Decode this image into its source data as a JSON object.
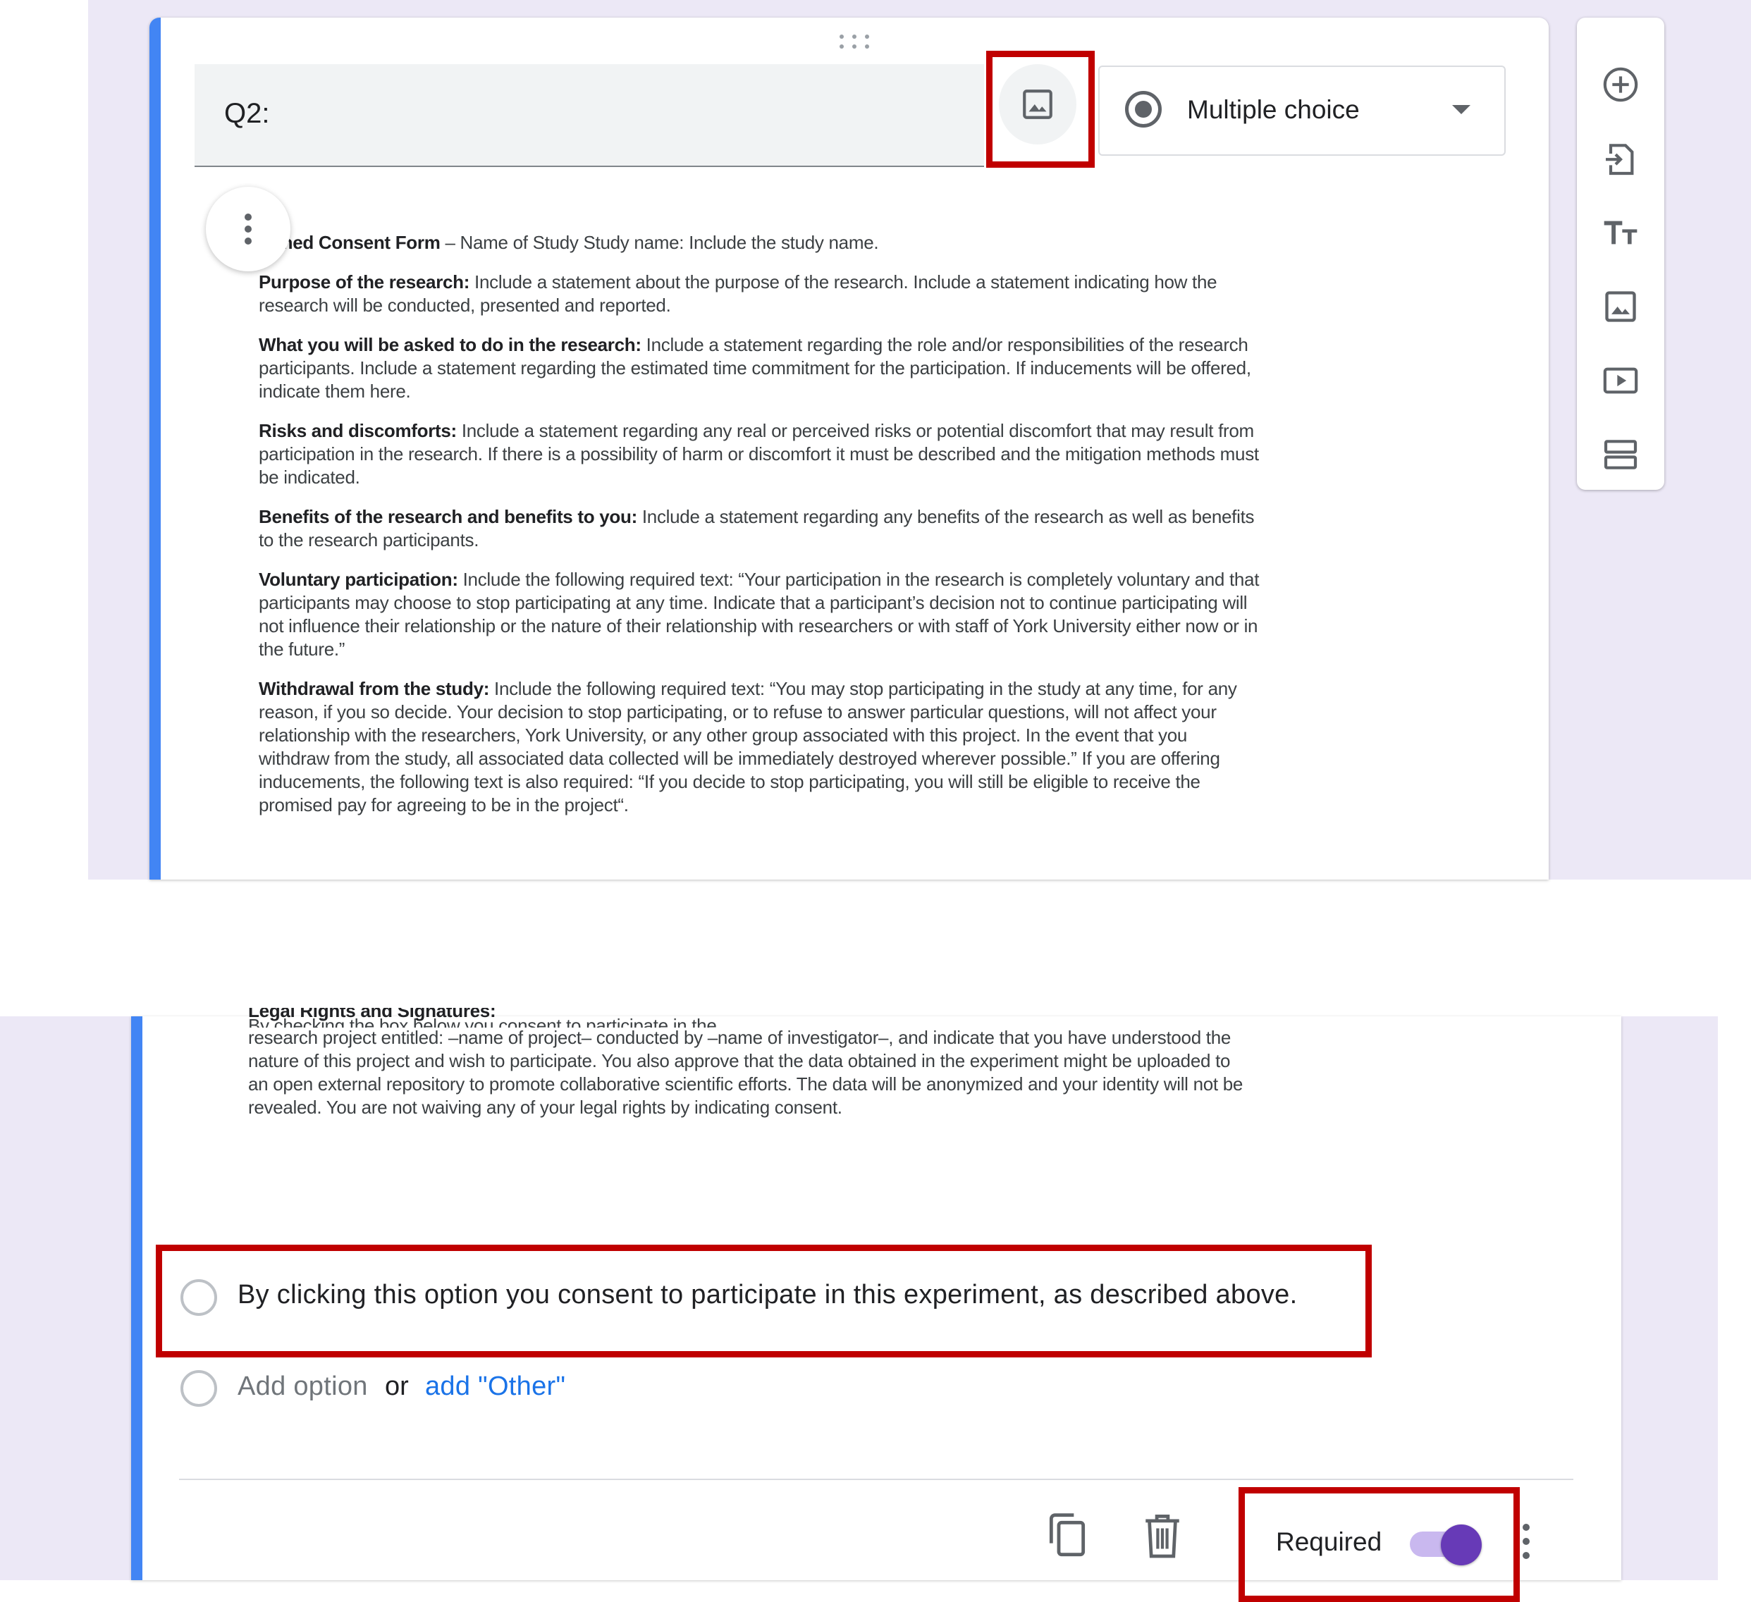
{
  "question": {
    "title": "Q2:",
    "type_label": "Multiple choice"
  },
  "consent_image": {
    "heading_bold": "ormed Consent Form",
    "heading_rest": " – Name of Study Study name: Include the study name.",
    "paragraphs": [
      {
        "bold": "Purpose of the research:",
        "text": " Include a statement about the purpose of the research. Include a statement indicating how the research will be conducted, presented and reported."
      },
      {
        "bold": "What you will be asked to do in the research:",
        "text": " Include a statement regarding the role and/or responsibilities of the research participants. Include a statement regarding the estimated time commitment for the participation. If inducements will be offered, indicate them here."
      },
      {
        "bold": "Risks and discomforts:",
        "text": " Include a statement regarding any real or perceived risks or potential discomfort that may result from participation in the research. If there is a possibility of harm or discomfort it must be described and the mitigation methods must be indicated."
      },
      {
        "bold": "Benefits of the research and benefits to you:",
        "text": " Include a statement regarding any benefits of the research as well as benefits to the research participants."
      },
      {
        "bold": "Voluntary participation:",
        "text": " Include the following required text: “Your participation in the research is completely voluntary and that participants may choose to stop participating at any time. Indicate that a participant’s decision not to continue participating will not influence their relationship or the nature of their relationship with researchers or with staff of York University either now or in the future.”"
      },
      {
        "bold": "Withdrawal from the study:",
        "text": " Include the following required text: “You may stop participating in the study at any time, for any reason, if you so decide. Your decision to stop participating, or to refuse to answer particular questions, will not affect your relationship with the researchers, York University, or any other group associated with this project. In the event that you withdraw from the study, all associated data collected will be immediately destroyed wherever possible.” If you are offering inducements, the following text is also required: “If you decide to stop participating, you will still be eligible to receive the promised pay for agreeing to be in the project“."
      }
    ],
    "legal_partial_bold": "Legal Rights and Signatures:",
    "legal_partial_text": " By checking the box below you consent to participate in the",
    "legal_text": "research project entitled: –name of project– conducted by –name of investigator–, and indicate that you have understood the nature of this project and wish to participate. You also approve that the data obtained in the experiment might be uploaded to an open external repository to promote collaborative scientific efforts. The data will be anonymized and your identity will not be revealed. You are not waiving any of your legal rights by indicating consent."
  },
  "options": [
    {
      "label": "By clicking this option you consent to participate in this experiment, as described above."
    }
  ],
  "add_option": {
    "label": "Add option",
    "or": "or",
    "other_link": "add \"Other\""
  },
  "footer": {
    "required_label": "Required",
    "required_on": true
  },
  "side_toolbar": [
    "add-question-icon",
    "import-questions-icon",
    "add-title-icon",
    "add-image-icon",
    "add-video-icon",
    "add-section-icon"
  ],
  "colors": {
    "accent_blue": "#4285f4",
    "toggle_purple": "#673ab7",
    "highlight_red": "#c00000",
    "background_lavender": "#ece8f6",
    "link_blue": "#1a73e8"
  }
}
